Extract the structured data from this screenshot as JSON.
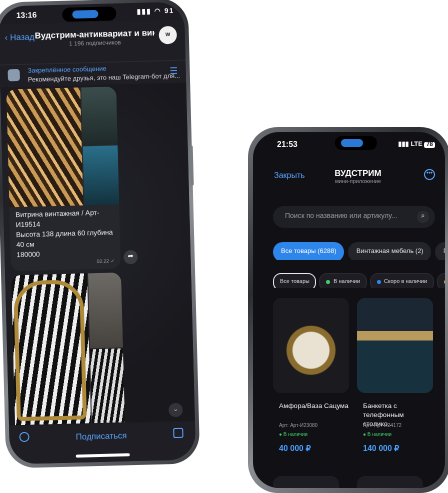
{
  "phone1": {
    "status": {
      "time": "13:16",
      "signal": "▮▮▮ ◠ 91"
    },
    "header": {
      "back_label": "Назад",
      "channel_title": "Вудстрим-антиквариат и винт...",
      "subscribers": "1 196 подписчиков",
      "avatar_text": "W"
    },
    "pinned": {
      "label": "Закреплённое сообщение",
      "text": "Рекомендуйте друзья, это наш Telegram-бот для..."
    },
    "post1": {
      "title": "Витрина винтажная / Арт-И19514",
      "dims": "Высота 138 длина 60 глубина 40 см",
      "price": "180000",
      "time": "02.22 ✓"
    },
    "bottom": {
      "subscribe_label": "Подписаться"
    }
  },
  "phone2": {
    "status": {
      "time": "21:53",
      "signal": "▮▮▮ LTE",
      "battery": "78"
    },
    "header": {
      "close_label": "Закрыть",
      "title": "ВУДСТРИМ",
      "subtitle": "мини-приложение",
      "more": "•••"
    },
    "search": {
      "placeholder": "Поиск по названию или артикулу..."
    },
    "categories": [
      {
        "label": "Все товары (6288)"
      },
      {
        "label": "Винтажная мебель (2)"
      },
      {
        "label": "Г"
      }
    ],
    "filters": [
      {
        "label": "Все товары"
      },
      {
        "label": "В наличии"
      },
      {
        "label": "Скоро в наличии"
      },
      {
        "label": "П"
      }
    ],
    "products": [
      {
        "name": "Амфора/Ваза Сацума",
        "article": "Арт: Арт-И23080",
        "stock": "● В наличии",
        "price": "40 000 ₽"
      },
      {
        "name": "Банкетка с телефонным столико...",
        "article": "Арт: Арт-И24172",
        "stock": "● В наличии",
        "price": "140 000 ₽"
      }
    ]
  },
  "colors": {
    "accent": "#2f86ea",
    "link": "#5aa4ff",
    "instock": "#3fcf6a"
  }
}
